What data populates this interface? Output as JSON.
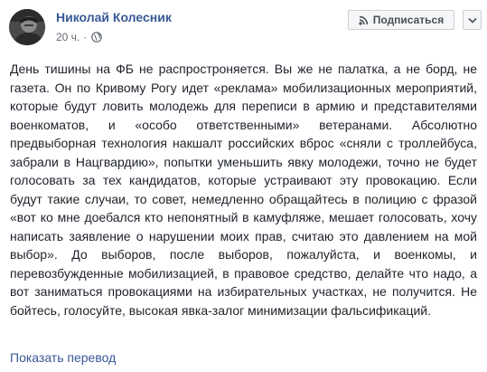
{
  "post": {
    "author_name": "Николай Колесник",
    "timestamp": "20 ч.",
    "separator": "·",
    "privacy_icon": "globe-icon",
    "subscribe_label": "Подписаться",
    "subscribe_icon": "rss-icon",
    "more_icon": "chevron-down-icon",
    "text": "День тишины на ФБ не распростроняется. Вы же не палатка, а не борд, не газета. Он по Кривому Рогу идет «реклама» мобилизационных мероприятий, которые будут ловить молодежь для переписи в армию и представителями военкоматов, и «особо ответственными» ветеранами. Абсолютно предвыборная технология накшалт российских вброс «сняли с троллейбуса, забрали в Нацгвардию», попытки уменьшить явку молодежи, точно не будет голосовать за тех кандидатов, которые устраивают эту провокацию. Если будут такие случаи, то совет, немедленно обращайтесь в полицию с фразой «вот ко мне доебался кто непонятный в камуфляже, мешает голосовать, хочу написать заявление о нарушении моих прав, считаю это давлением на мой выбор». До выборов, после выборов, пожалуйста, и военкомы, и перевозбужденные мобилизацией, в правовое средство, делайте что надо, а вот заниматься провокациями на избирательных участках, не получится. Не бойтесь, голосуйте, высокая явка-залог минимизации фальсификаций.",
    "translate_label": "Показать перевод"
  },
  "colors": {
    "link": "#385898",
    "text": "#1d2129",
    "meta": "#616770",
    "button_bg": "#f5f6f7",
    "button_border": "#ccd0d5"
  }
}
